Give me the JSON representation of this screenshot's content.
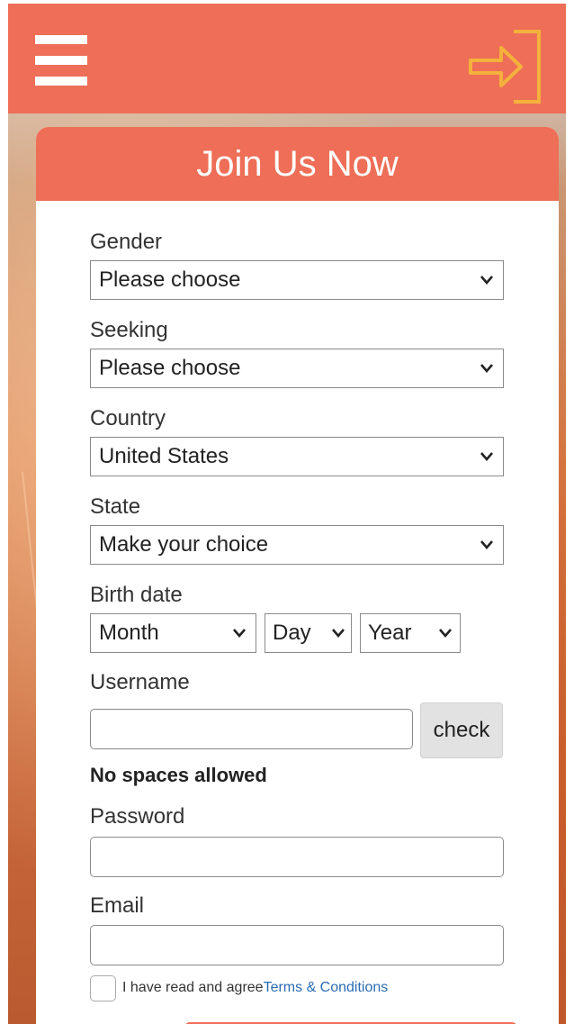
{
  "header": {
    "menu_icon": "hamburger-menu-icon",
    "login_icon": "sign-in-arrow-icon"
  },
  "form": {
    "title": "Join Us Now",
    "gender": {
      "label": "Gender",
      "value": "Please choose"
    },
    "seeking": {
      "label": "Seeking",
      "value": "Please choose"
    },
    "country": {
      "label": "Country",
      "value": "United States"
    },
    "state": {
      "label": "State",
      "value": "Make your choice"
    },
    "birth_date": {
      "label": "Birth date",
      "month": "Month",
      "day": "Day",
      "year": "Year"
    },
    "username": {
      "label": "Username",
      "value": "",
      "check_label": "check",
      "hint": "No spaces allowed"
    },
    "password": {
      "label": "Password",
      "value": ""
    },
    "email": {
      "label": "Email",
      "value": ""
    },
    "agree": {
      "text": "I have read and agree",
      "link": "Terms & Conditions",
      "checked": false
    }
  },
  "colors": {
    "accent": "#ee6e57",
    "login_icon": "#f4b13c",
    "link": "#2a6cb3"
  }
}
